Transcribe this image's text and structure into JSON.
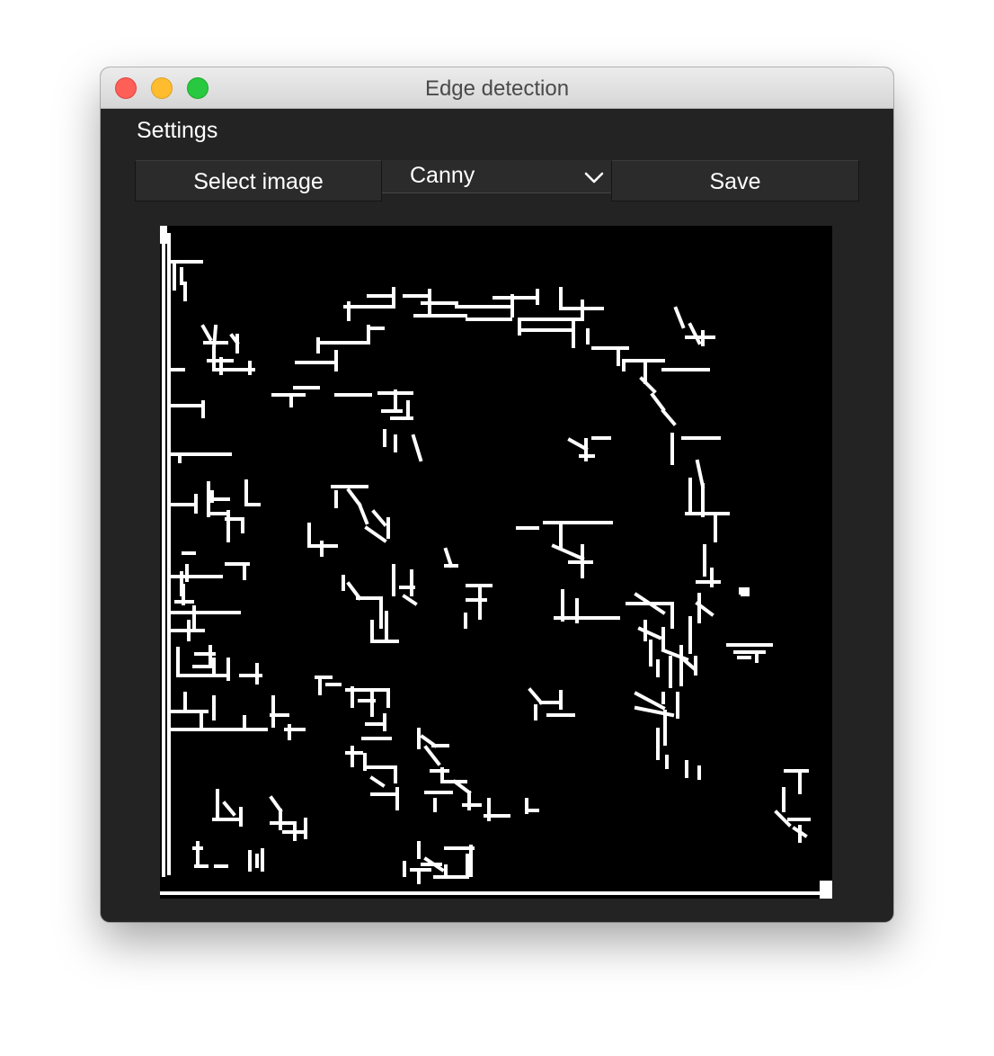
{
  "window": {
    "title": "Edge detection"
  },
  "menu": {
    "settings_label": "Settings"
  },
  "toolbar": {
    "select_image_label": "Select image",
    "method_selected": "Canny",
    "save_label": "Save"
  },
  "colors": {
    "window_background": "#232323",
    "edge_color": "#ffffff",
    "image_background": "#000000"
  }
}
